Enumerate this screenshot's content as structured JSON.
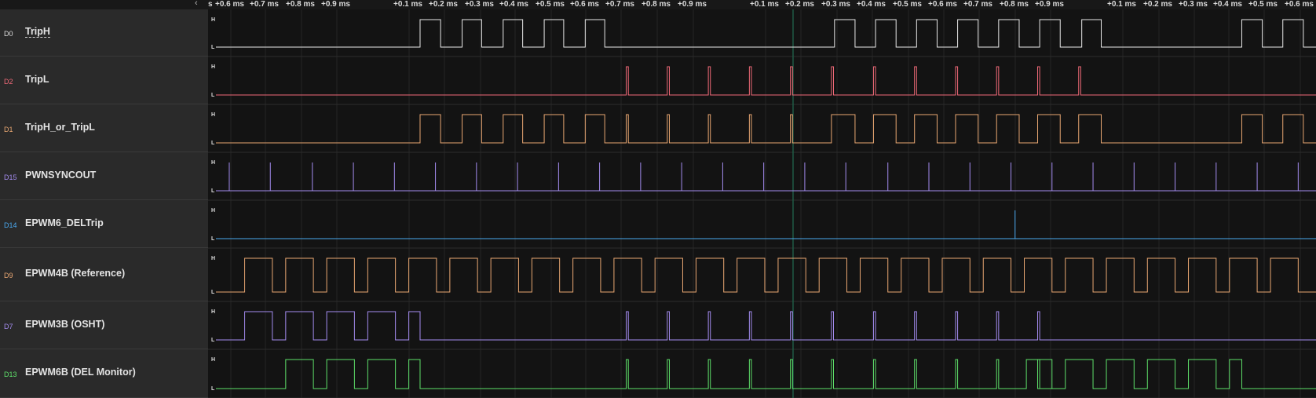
{
  "ruler": {
    "ticks": [
      "s",
      "+0.6 ms",
      "+0.7 ms",
      "+0.8 ms",
      "+0.9 ms",
      "+0.1 ms",
      "+0.2 ms",
      "+0.3 ms",
      "+0.4 ms",
      "+0.5 ms",
      "+0.6 ms",
      "+0.7 ms",
      "+0.8 ms",
      "+0.9 ms",
      "+0.1 ms",
      "+0.2 ms",
      "+0.3 ms",
      "+0.4 ms",
      "+0.5 ms",
      "+0.6 ms",
      "+0.7 ms",
      "+0.8 ms",
      "+0.9 ms",
      "+0.1 ms",
      "+0.2 ms",
      "+0.3 ms",
      "+0.4 ms",
      "+0.5 ms",
      "+0.6 ms"
    ],
    "collapse_icon": "chevron-left-icon"
  },
  "level_labels": {
    "high": "H",
    "low": "L"
  },
  "channels": [
    {
      "id": "D0",
      "name": "TripH",
      "color": "#e8e8e8",
      "id_color": "#dddddd",
      "type": "pulses",
      "pulses": [
        [
          0.199,
          0.219
        ],
        [
          0.24,
          0.259
        ],
        [
          0.28,
          0.299
        ],
        [
          0.32,
          0.339
        ],
        [
          0.36,
          0.379
        ],
        [
          0.603,
          0.623
        ],
        [
          0.643,
          0.663
        ],
        [
          0.683,
          0.703
        ],
        [
          0.723,
          0.743
        ],
        [
          0.763,
          0.783
        ],
        [
          0.803,
          0.823
        ],
        [
          0.844,
          0.863
        ],
        [
          1.0,
          1.02
        ],
        [
          1.04,
          1.06
        ]
      ]
    },
    {
      "id": "D2",
      "name": "TripL",
      "color": "#f06a78",
      "id_color": "#f06a78",
      "type": "pulses",
      "pulses": [
        [
          0.4,
          0.402
        ],
        [
          0.44,
          0.442
        ],
        [
          0.48,
          0.482
        ],
        [
          0.52,
          0.522
        ],
        [
          0.56,
          0.562
        ],
        [
          0.6,
          0.602
        ],
        [
          0.641,
          0.643
        ],
        [
          0.681,
          0.683
        ],
        [
          0.721,
          0.723
        ],
        [
          0.761,
          0.763
        ],
        [
          0.801,
          0.803
        ],
        [
          0.841,
          0.843
        ]
      ]
    },
    {
      "id": "D1",
      "name": "TripH_or_TripL",
      "color": "#e9a772",
      "id_color": "#e9a772",
      "type": "pulses",
      "pulses": [
        [
          0.199,
          0.219
        ],
        [
          0.24,
          0.259
        ],
        [
          0.28,
          0.299
        ],
        [
          0.32,
          0.339
        ],
        [
          0.36,
          0.379
        ],
        [
          0.4,
          0.402
        ],
        [
          0.44,
          0.442
        ],
        [
          0.48,
          0.482
        ],
        [
          0.52,
          0.522
        ],
        [
          0.56,
          0.562
        ],
        [
          0.6,
          0.623
        ],
        [
          0.641,
          0.663
        ],
        [
          0.681,
          0.703
        ],
        [
          0.721,
          0.743
        ],
        [
          0.761,
          0.783
        ],
        [
          0.801,
          0.823
        ],
        [
          0.841,
          0.863
        ],
        [
          1.0,
          1.02
        ],
        [
          1.04,
          1.06
        ]
      ]
    },
    {
      "id": "D15",
      "name": "PWNSYNCOUT",
      "color": "#a48cf0",
      "id_color": "#a48cf0",
      "type": "spikes",
      "spikes": [
        0.013,
        0.053,
        0.094,
        0.134,
        0.174,
        0.214,
        0.254,
        0.294,
        0.334,
        0.374,
        0.414,
        0.454,
        0.494,
        0.534,
        0.574,
        0.614,
        0.655,
        0.695,
        0.735,
        0.775,
        0.815,
        0.855,
        0.895,
        0.935,
        0.975,
        1.015,
        1.055
      ]
    },
    {
      "id": "D14",
      "name": "EPWM6_DELTrip",
      "color": "#4aa8ee",
      "id_color": "#4aa8ee",
      "type": "spikes",
      "spikes": [
        0.779
      ]
    },
    {
      "id": "D9",
      "name": "EPWM4B (Reference)",
      "color": "#e9a772",
      "id_color": "#e9a772",
      "type": "square",
      "pulses": [
        [
          0.028,
          0.055
        ],
        [
          0.068,
          0.095
        ],
        [
          0.108,
          0.135
        ],
        [
          0.148,
          0.175
        ],
        [
          0.188,
          0.215
        ],
        [
          0.228,
          0.255
        ],
        [
          0.268,
          0.295
        ],
        [
          0.308,
          0.335
        ],
        [
          0.348,
          0.375
        ],
        [
          0.388,
          0.415
        ],
        [
          0.428,
          0.455
        ],
        [
          0.468,
          0.495
        ],
        [
          0.508,
          0.535
        ],
        [
          0.548,
          0.575
        ],
        [
          0.588,
          0.615
        ],
        [
          0.628,
          0.655
        ],
        [
          0.668,
          0.695
        ],
        [
          0.708,
          0.735
        ],
        [
          0.748,
          0.775
        ],
        [
          0.788,
          0.815
        ],
        [
          0.828,
          0.855
        ],
        [
          0.868,
          0.895
        ],
        [
          0.908,
          0.935
        ],
        [
          0.948,
          0.975
        ],
        [
          0.988,
          1.015
        ],
        [
          1.028,
          1.055
        ]
      ]
    },
    {
      "id": "D7",
      "name": "EPWM3B (OSHT)",
      "color": "#a48cf0",
      "id_color": "#a48cf0",
      "type": "pulses",
      "pulses": [
        [
          0.028,
          0.055
        ],
        [
          0.068,
          0.095
        ],
        [
          0.108,
          0.135
        ],
        [
          0.148,
          0.175
        ],
        [
          0.188,
          0.199
        ],
        [
          0.4,
          0.402
        ],
        [
          0.44,
          0.442
        ],
        [
          0.48,
          0.482
        ],
        [
          0.52,
          0.522
        ],
        [
          0.56,
          0.562
        ],
        [
          0.6,
          0.602
        ],
        [
          0.641,
          0.643
        ],
        [
          0.681,
          0.683
        ],
        [
          0.721,
          0.723
        ],
        [
          0.761,
          0.763
        ],
        [
          0.801,
          0.803
        ]
      ]
    },
    {
      "id": "D13",
      "name": "EPWM6B (DEL Monitor)",
      "color": "#5ee06a",
      "id_color": "#5ee06a",
      "type": "pulses",
      "pulses": [
        [
          0.068,
          0.095
        ],
        [
          0.108,
          0.135
        ],
        [
          0.148,
          0.175
        ],
        [
          0.188,
          0.199
        ],
        [
          0.4,
          0.402
        ],
        [
          0.44,
          0.442
        ],
        [
          0.48,
          0.482
        ],
        [
          0.52,
          0.522
        ],
        [
          0.56,
          0.562
        ],
        [
          0.6,
          0.602
        ],
        [
          0.641,
          0.643
        ],
        [
          0.681,
          0.683
        ],
        [
          0.721,
          0.723
        ],
        [
          0.761,
          0.763
        ],
        [
          0.801,
          0.803
        ],
        [
          0.79,
          0.815
        ],
        [
          0.828,
          0.855
        ],
        [
          0.868,
          0.895
        ],
        [
          0.908,
          0.935
        ],
        [
          0.948,
          0.975
        ],
        [
          0.988,
          1.0
        ]
      ]
    }
  ]
}
